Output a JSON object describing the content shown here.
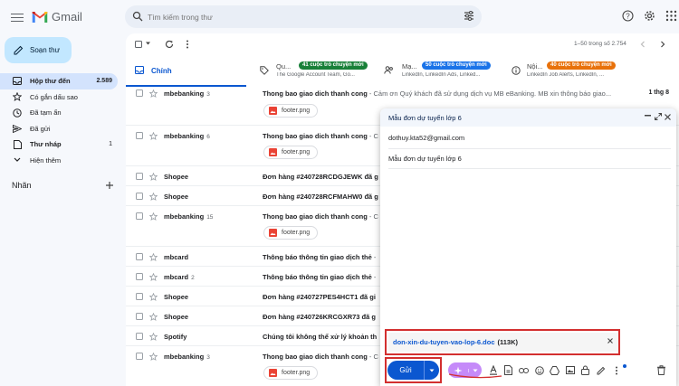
{
  "app": {
    "name": "Gmail"
  },
  "search": {
    "placeholder": "Tìm kiếm trong thư"
  },
  "sidebar": {
    "compose_label": "Soạn thư",
    "items": [
      {
        "label": "Hộp thư đến",
        "count": "2.589",
        "active": true
      },
      {
        "label": "Có gắn dấu sao",
        "count": ""
      },
      {
        "label": "Đã tạm ẩn",
        "count": ""
      },
      {
        "label": "Đã gửi",
        "count": ""
      },
      {
        "label": "Thư nháp",
        "count": "1"
      },
      {
        "label": "Hiện thêm",
        "count": ""
      }
    ],
    "labels_title": "Nhãn"
  },
  "toolbar": {
    "pager": "1–50 trong số 2.754"
  },
  "tabs": {
    "primary": "Chính",
    "promotions": {
      "name": "Qu...",
      "badge": "41 cuộc trò chuyện mới",
      "sub": "The Google Account Team, Go...",
      "color": "#188038"
    },
    "social": {
      "name": "Mạ...",
      "badge": "50 cuộc trò chuyện mới",
      "sub": "LinkedIn, LinkedIn Ads, Linked...",
      "color": "#1a73e8"
    },
    "updates": {
      "name": "Nội...",
      "badge": "40 cuộc trò chuyện mới",
      "sub": "LinkedIn Job Alerts, LinkedIn, ...",
      "color": "#e8710a"
    }
  },
  "emails": [
    {
      "sender": "mbebanking",
      "count": "3",
      "subject": "Thong bao giao dich thanh cong",
      "snippet": " - Cảm ơn Quý khách đã sử dụng dịch vụ MB eBanking. MB xin thông báo giao...",
      "date": "1 thg 8",
      "attachment": "footer.png"
    },
    {
      "sender": "mbebanking",
      "count": "6",
      "subject": "Thong bao giao dich thanh cong",
      "snippet": " - C",
      "date": "",
      "attachment": "footer.png"
    },
    {
      "sender": "Shopee",
      "count": "",
      "subject": "Đơn hàng #240728RCDGJEWK đã g",
      "snippet": "",
      "date": "",
      "attachment": ""
    },
    {
      "sender": "Shopee",
      "count": "",
      "subject": "Đơn hàng #240728RCFMAHW0 đã g",
      "snippet": "",
      "date": "",
      "attachment": ""
    },
    {
      "sender": "mbebanking",
      "count": "15",
      "subject": "Thong bao giao dich thanh cong",
      "snippet": " - C",
      "date": "",
      "attachment": "footer.png"
    },
    {
      "sender": "mbcard",
      "count": "",
      "subject": "Thông báo thông tin giao dịch thẻ",
      "snippet": " -",
      "date": "",
      "attachment": ""
    },
    {
      "sender": "mbcard",
      "count": "2",
      "subject": "Thông báo thông tin giao dịch thẻ",
      "snippet": " -",
      "date": "",
      "attachment": ""
    },
    {
      "sender": "Shopee",
      "count": "",
      "subject": "Đơn hàng #240727PES4HCT1 đã gi",
      "snippet": "",
      "date": "",
      "attachment": ""
    },
    {
      "sender": "Shopee",
      "count": "",
      "subject": "Đơn hàng #240726KRCGXR73 đã g",
      "snippet": "",
      "date": "",
      "attachment": ""
    },
    {
      "sender": "Spotify",
      "count": "",
      "subject": "Chúng tôi không thể xử lý khoản th",
      "snippet": "",
      "date": "",
      "attachment": ""
    },
    {
      "sender": "mbebanking",
      "count": "3",
      "subject": "Thong bao giao dich thanh cong",
      "snippet": " - C",
      "date": "",
      "attachment": "footer.png"
    }
  ],
  "compose_window": {
    "title": "Mẫu đơn dự tuyển lớp 6",
    "to": "dothuy.kta52@gmail.com",
    "subject": "Mẫu đơn dự tuyển lớp 6",
    "attachment_name": "don-xin-du-tuyen-vao-lop-6.doc",
    "attachment_size": "(113K)",
    "send_label": "Gửi"
  },
  "colors": {
    "accent": "#0b57d0",
    "highlight": "#d32f2f",
    "ai": "#c58af9"
  }
}
